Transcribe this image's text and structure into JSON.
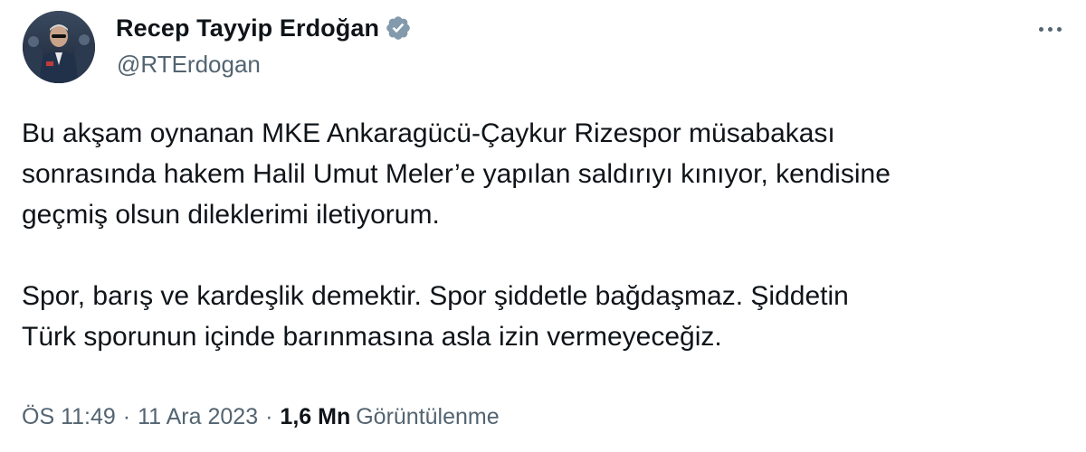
{
  "author": {
    "display_name": "Recep Tayyip Erdoğan",
    "handle": "@RTErdogan",
    "verified_icon": "verified-badge-icon",
    "avatar_icon": "profile-avatar"
  },
  "more_icon": "more-options-icon",
  "tweet": {
    "paragraph1": [
      "Bu akşam oynanan MKE Ankaragücü-Çaykur Rizespor müsabakası",
      "sonrasında hakem Halil Umut Meler’e yapılan saldırıyı kınıyor, kendisine",
      "geçmiş olsun dileklerimi iletiyorum."
    ],
    "paragraph2": [
      "Spor, barış ve kardeşlik demektir. Spor şiddetle bağdaşmaz. Şiddetin",
      "Türk sporunun içinde barınmasına asla izin vermeyeceğiz."
    ]
  },
  "meta": {
    "time": "ÖS 11:49",
    "separator": "·",
    "date": "11 Ara 2023",
    "views_count": "1,6 Mn",
    "views_label": "Görüntülenme"
  },
  "colors": {
    "text_primary": "#0f1419",
    "text_secondary": "#536471",
    "verified": "#829aab"
  }
}
